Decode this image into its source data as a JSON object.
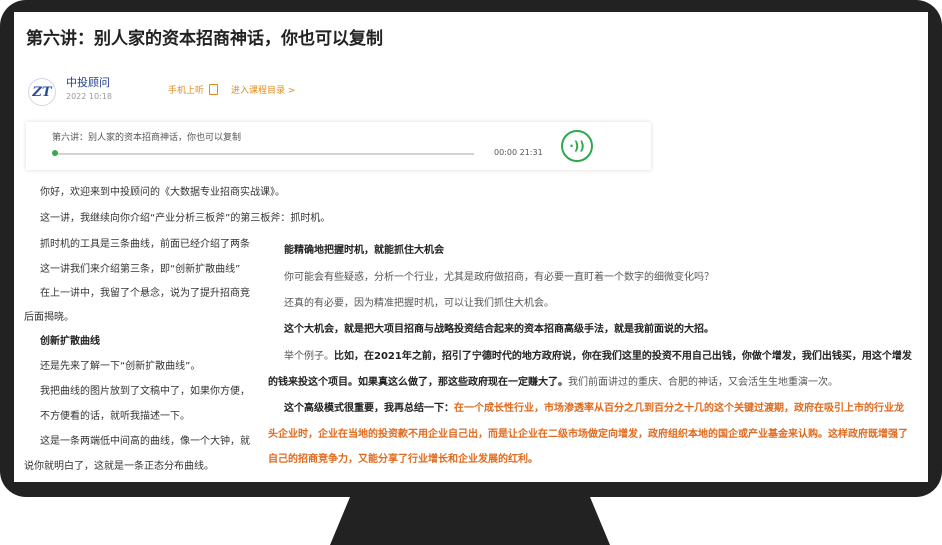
{
  "article": {
    "title": "第六讲：别人家的资本招商神话，你也可以复制",
    "author": "中投顾问",
    "date": "2022 10:18",
    "listen_label": "手机上听",
    "catalog_label": "进入课程目录 >"
  },
  "player": {
    "track_title": "第六讲：别人家的资本招商神话，你也可以复制",
    "time": "00:00 21:31",
    "progress": 0.0
  },
  "left_column": [
    "你好，欢迎来到中投顾问的《大数据专业招商实战课》。",
    "这一讲，我继续向你介绍“产业分析三板斧”的第三板斧：抓时机。",
    "抓时机的工具是三条曲线，前面已经介绍了两条",
    "这一讲我们来介绍第三条，即“创新扩散曲线”",
    "在上一讲中，我留了个悬念，说为了提升招商竞",
    "后面揭晓。",
    "创新扩散曲线",
    "还是先来了解一下“创新扩散曲线”。",
    "我把曲线的图片放到了文稿中了，如果你方便，",
    "不方便看的话，就听我描述一下。",
    "这是一条两端低中间高的曲线，像一个大钟，就",
    "说你就明白了，这就是一条正态分布曲线。"
  ],
  "right_column": {
    "heading": "能精确地把握时机，就能抓住大机会",
    "q": "你可能会有些疑惑，分析一个行业，尤其是政府做招商，有必要一直盯着一个数字的细微变化吗？",
    "a": "还真的有必要，因为精准把握时机，可以让我们抓住大机会。",
    "big_chance": "这个大机会，就是把大项目招商与战略投资结合起来的资本招商高级手法，就是我前面说的大招。",
    "example_lead": "举个例子。",
    "example_bold_1": "比如，在2021年之前，招引了宁德时代的地方政府说，你在我们这里的投资不用自己出钱，你做个增发，我们出钱买，用这个增发",
    "example_bold_2": "的钱来投这个项目。如果真这么做了，那这些政府现在一定赚大了。",
    "example_tail": "我们前面讲过的重庆、合肥的神话，又会活生生地重演一次。",
    "summary_lead": "这个高级模式很重要，我再总结一下：",
    "summary_orange_1": "在一个成长性行业，市场渗透率从百分之几到百分之十几的这个关键过渡期，政府在吸引上市的行业龙",
    "summary_orange_2": "头企业时，企业在当地的投资款不用企业自己出，而是让企业在二级市场做定向增发，政府组织本地的国企或产业基金来认购。这样政府既增强了",
    "summary_orange_3": "自己的招商竞争力，又能分享了行业增长和企业发展的红利。"
  }
}
